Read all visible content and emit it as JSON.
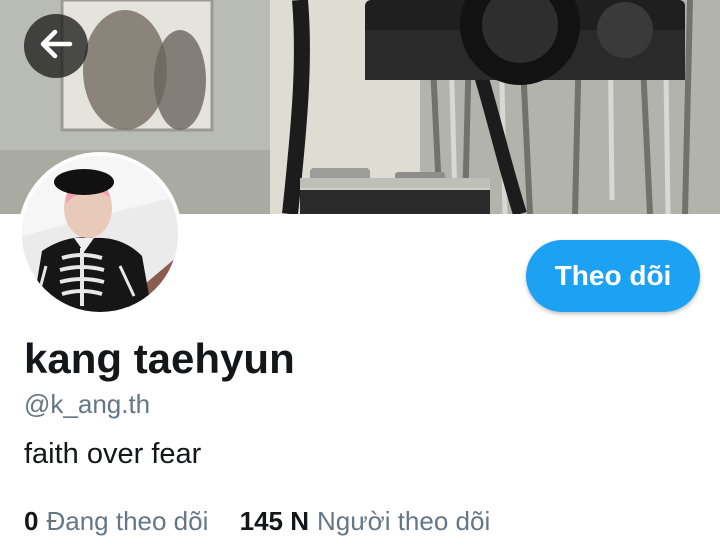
{
  "profile": {
    "display_name": "kang taehyun",
    "handle": "@k_ang.th",
    "bio": "faith over fear"
  },
  "actions": {
    "follow_label": "Theo dõi",
    "back_icon": "arrow-left-icon"
  },
  "stats": {
    "following_count": "0",
    "following_label": "Đang theo dõi",
    "followers_count": "145 N",
    "followers_label": "Người theo dõi"
  },
  "colors": {
    "accent": "#1da1f2",
    "primary_text": "#14171a",
    "secondary_text": "#657786"
  }
}
